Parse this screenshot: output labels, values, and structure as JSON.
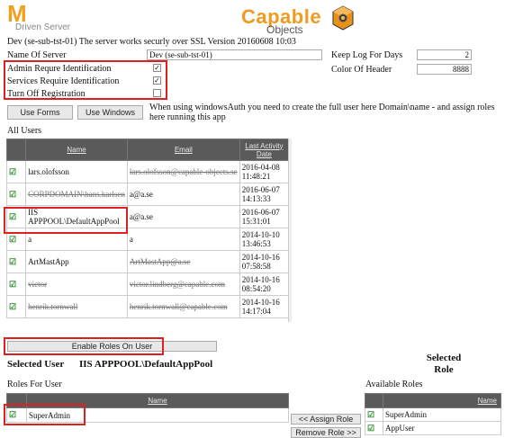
{
  "header": {
    "logo_letter": "M",
    "logo_sub": "Driven Server",
    "brand_name": "Capable",
    "brand_sub": "Objects",
    "server_line": "Dev (se-sub-tst-01)  The server works securly over SSL Version 20160608 10:03"
  },
  "settings": {
    "name_of_server_label": "Name Of Server",
    "name_of_server_value": "Dev (se-sub-tst-01)",
    "keep_log_label": "Keep Log For Days",
    "keep_log_value": "2",
    "color_header_label": "Color Of Header",
    "color_header_value": "8888",
    "admin_req_label": "Admin Requre Identification",
    "services_req_label": "Services Require Identification",
    "turn_off_label": "Turn Off Registration",
    "check_mark": "✓"
  },
  "buttons": {
    "use_forms": "Use Forms",
    "use_windows": "Use Windows",
    "enable_roles": "Enable Roles On User",
    "assign_role": "<< Assign Role",
    "remove_role": "Remove Role >>"
  },
  "info_text": "When using windowsAuth you need to create the full user here Domain\\name - and assign roles here running this app",
  "users": {
    "title": "All Users",
    "columns": {
      "name": "Name",
      "email": "Email",
      "last": "Last Activity Date"
    },
    "rows": [
      {
        "name": "lars.olofsson",
        "email": "lars.olofsson@capable-objects.se",
        "date": "2016-04-08",
        "time": "11:48:21"
      },
      {
        "name": "CORPDOMAIN\\hans.karlsen",
        "email": "a@a.se",
        "date": "2016-06-07",
        "time": "14:13:33"
      },
      {
        "name": "IIS APPPOOL\\DefaultAppPool",
        "email": "a@a.se",
        "date": "2016-06-07",
        "time": "15:31:01"
      },
      {
        "name": "a",
        "email": "a",
        "date": "2014-10-10",
        "time": "13:46:53"
      },
      {
        "name": "ArtMastApp",
        "email": "ArtMastApp@a.se",
        "date": "2014-10-16",
        "time": "07:58:58"
      },
      {
        "name": "victor",
        "email": "victor.lindberg@capable.com",
        "date": "2014-10-16",
        "time": "08:54:20"
      },
      {
        "name": "henrik.tornwall",
        "email": "henrik.tornwall@capable.com",
        "date": "2014-10-16",
        "time": "14:17:04"
      }
    ]
  },
  "selection": {
    "selected_user_label": "Selected User",
    "selected_user_value": "IIS APPPOOL\\DefaultAppPool",
    "selected_role_label": "Selected Role",
    "roles_for_user_label": "Roles For User",
    "available_roles_label": "Available Roles",
    "name_col": "Name",
    "user_roles": [
      "SuperAdmin"
    ],
    "available_roles": [
      "SuperAdmin",
      "AppUser"
    ]
  }
}
